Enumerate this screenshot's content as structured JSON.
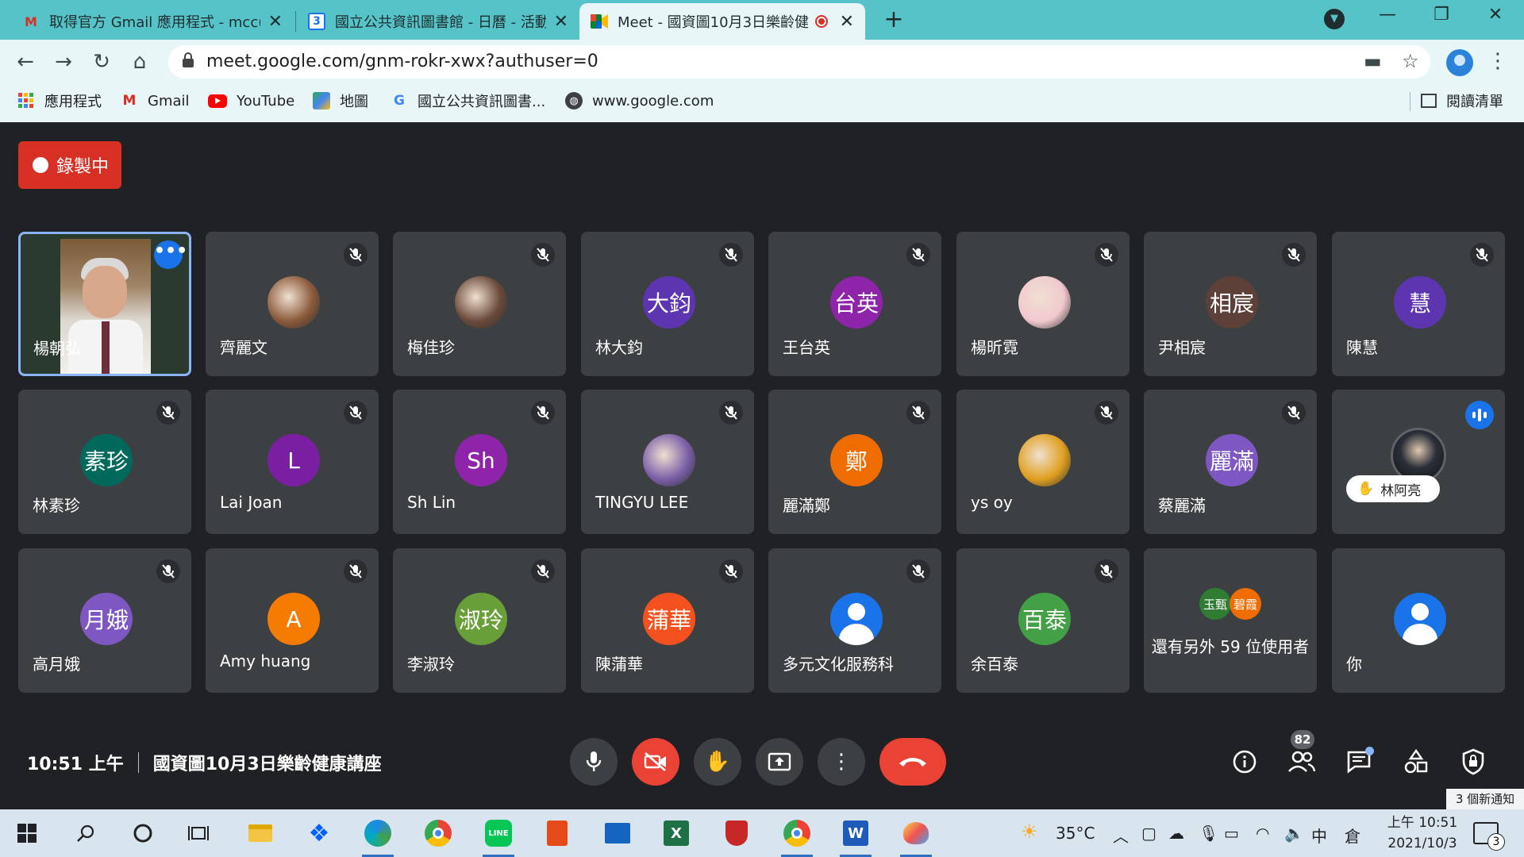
{
  "browser": {
    "tabs": [
      {
        "title": "取得官方 Gmail 應用程式 - mcc(",
        "favicon": "M"
      },
      {
        "title": "國立公共資訊圖書館 - 日曆 - 活動",
        "favicon": "3"
      },
      {
        "title": "Meet - 國資圖10月3日樂齡健",
        "favicon": "meet",
        "recording": true
      }
    ],
    "url": "meet.google.com/gnm-rokr-xwx?authuser=0",
    "bookmarks": [
      {
        "label": "應用程式",
        "icon": "apps-grid-icon"
      },
      {
        "label": "Gmail",
        "icon": "gmail-icon"
      },
      {
        "label": "YouTube",
        "icon": "youtube-icon"
      },
      {
        "label": "地圖",
        "icon": "maps-icon"
      },
      {
        "label": "國立公共資訊圖書...",
        "icon": "google-icon"
      },
      {
        "label": "www.google.com",
        "icon": "globe-icon"
      }
    ],
    "reading_list": "閱讀清單"
  },
  "meet": {
    "recording_label": "錄製中",
    "participants": [
      {
        "name": "楊朝弘",
        "type": "video"
      },
      {
        "name": "齊麗文",
        "type": "photo",
        "color": "#8a5a3c"
      },
      {
        "name": "梅佳珍",
        "type": "photo",
        "color": "#6b4a3a"
      },
      {
        "name": "林大鈞",
        "initials": "大鈞",
        "color": "#5e35b1"
      },
      {
        "name": "王台英",
        "initials": "台英",
        "color": "#8e24aa"
      },
      {
        "name": "楊昕霓",
        "type": "photo",
        "color": "#f1c9cf"
      },
      {
        "name": "尹相宸",
        "initials": "相宸",
        "color": "#5d4037"
      },
      {
        "name": "陳慧",
        "initials": "慧",
        "color": "#5e35b1"
      },
      {
        "name": "林素珍",
        "initials": "素珍",
        "color": "#00695c"
      },
      {
        "name": "Lai Joan",
        "initials": "L",
        "color": "#7b1fa2"
      },
      {
        "name": "Sh Lin",
        "initials": "Sh",
        "color": "#8e24aa"
      },
      {
        "name": "TINGYU LEE",
        "type": "photo",
        "color": "#7a5fa8"
      },
      {
        "name": "麗滿鄭",
        "initials": "鄭",
        "color": "#ef6c00"
      },
      {
        "name": "ys oy",
        "type": "photo",
        "color": "#e0a020"
      },
      {
        "name": "蔡麗滿",
        "initials": "麗滿",
        "color": "#7e57c2"
      },
      {
        "name": "林阿亮",
        "type": "hand-raised"
      },
      {
        "name": "高月娥",
        "initials": "月娥",
        "color": "#7e57c2"
      },
      {
        "name": "Amy huang",
        "initials": "A",
        "color": "#f57c00"
      },
      {
        "name": "李淑玲",
        "initials": "淑玲",
        "color": "#689f38"
      },
      {
        "name": "陳蒲華",
        "initials": "蒲華",
        "color": "#f4511e"
      },
      {
        "name": "多元文化服務科",
        "type": "person"
      },
      {
        "name": "余百泰",
        "initials": "百泰",
        "color": "#43a047"
      },
      {
        "name": "還有另外 59 位使用者",
        "type": "others",
        "minis": [
          {
            "initials": "玉甄",
            "color": "#2e7d32"
          },
          {
            "initials": "碧霞",
            "color": "#ef6c00"
          }
        ]
      },
      {
        "name": "你",
        "type": "person"
      }
    ],
    "time": "10:51 上午",
    "meeting_title": "國資圖10月3日樂齡健康講座",
    "participant_count": "82",
    "notification_toast": "3 個新通知"
  },
  "taskbar": {
    "weather": "35°C",
    "ime": "中",
    "ime2": "倉",
    "clock_time": "上午 10:51",
    "clock_date": "2021/10/3",
    "notifications": "3"
  }
}
